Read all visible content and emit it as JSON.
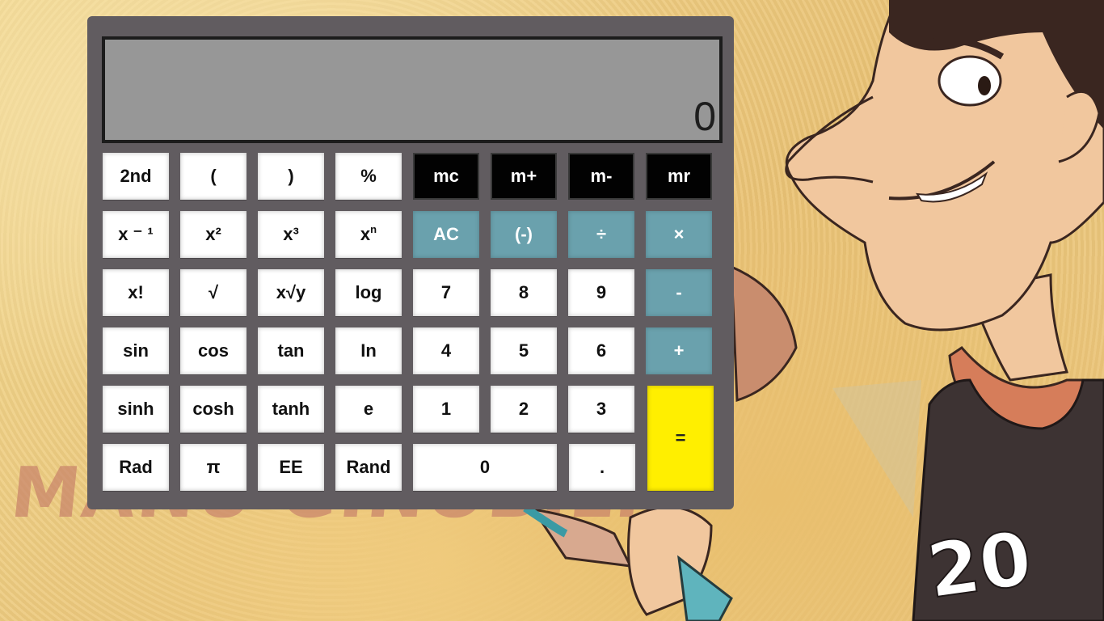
{
  "background": {
    "caption": "MANU GINOBILI",
    "jersey_number": "20"
  },
  "display": {
    "value": "0"
  },
  "keys": {
    "second": "2nd",
    "paren_open": "(",
    "paren_close": ")",
    "percent": "%",
    "mc": "mc",
    "m_plus": "m+",
    "m_minus": "m-",
    "mr": "mr",
    "x_inverse": "x ⁻ ¹",
    "x_squared": "x²",
    "x_cubed": "x³",
    "x_power_base": "x",
    "x_power_exp": "n",
    "ac": "AC",
    "negate": "(-)",
    "divide": "÷",
    "multiply": "×",
    "factorial": "x!",
    "sqrt": "√",
    "x_root_y": "x√y",
    "log": "log",
    "seven": "7",
    "eight": "8",
    "nine": "9",
    "minus": "-",
    "sin": "sin",
    "cos": "cos",
    "tan": "tan",
    "ln": "In",
    "four": "4",
    "five": "5",
    "six": "6",
    "plus": "+",
    "sinh": "sinh",
    "cosh": "cosh",
    "tanh": "tanh",
    "e": "e",
    "one": "1",
    "two": "2",
    "three": "3",
    "equals": "=",
    "rad": "Rad",
    "pi": "π",
    "ee": "EE",
    "rand": "Rand",
    "zero": "0",
    "decimal": "."
  },
  "colors": {
    "body": "#615c60",
    "display": "#979797",
    "number_key": "#ffffff",
    "memory_key": "#020202",
    "operator_key": "#6aa1ad",
    "equals_key": "#ffef00"
  }
}
